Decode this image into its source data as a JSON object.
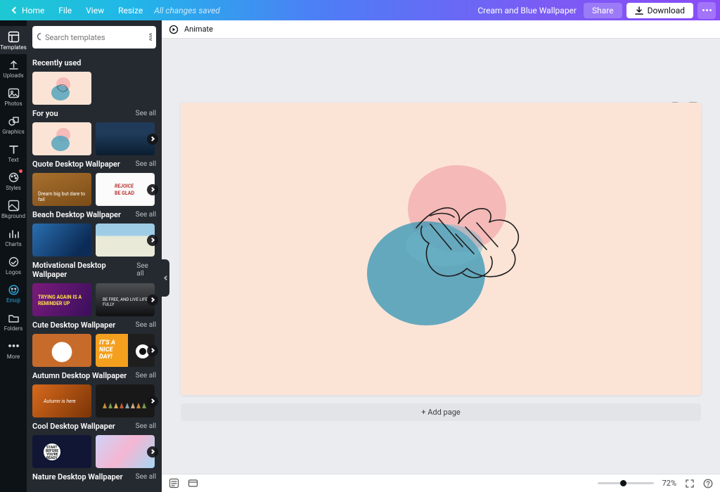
{
  "topbar": {
    "home": "Home",
    "file": "File",
    "view": "View",
    "resize": "Resize",
    "status": "All changes saved",
    "doc_title": "Cream and Blue Wallpaper",
    "share": "Share",
    "download": "Download"
  },
  "rail": [
    {
      "label": "Templates",
      "active": true
    },
    {
      "label": "Uploads"
    },
    {
      "label": "Photos"
    },
    {
      "label": "Graphics"
    },
    {
      "label": "Text"
    },
    {
      "label": "Styles",
      "badge": true
    },
    {
      "label": "Bkground"
    },
    {
      "label": "Charts"
    },
    {
      "label": "Logos"
    },
    {
      "label": "Emoji",
      "active_blue": true
    },
    {
      "label": "Folders"
    },
    {
      "label": "More"
    }
  ],
  "search": {
    "placeholder": "Search templates"
  },
  "sections": {
    "recent": {
      "title": "Recently used"
    },
    "foryou": {
      "title": "For you",
      "see_all": "See all"
    },
    "quote": {
      "title": "Quote Desktop Wallpaper",
      "see_all": "See all"
    },
    "beach": {
      "title": "Beach Desktop Wallpaper",
      "see_all": "See all"
    },
    "motiv": {
      "title": "Motivational Desktop Wallpaper",
      "see_all": "See all"
    },
    "cute": {
      "title": "Cute Desktop Wallpaper",
      "see_all": "See all"
    },
    "autumn": {
      "title": "Autumn Desktop Wallpaper",
      "see_all": "See all"
    },
    "cool": {
      "title": "Cool Desktop Wallpaper",
      "see_all": "See all"
    },
    "nature": {
      "title": "Nature Desktop Wallpaper",
      "see_all": "See all"
    }
  },
  "thumb_text": {
    "quote1": "Dream big but dare to fail",
    "quote2": "REJOICE",
    "quote2b": "BE GLAD",
    "motiv1a": "TRYING AGAIN IS A",
    "motiv1b": "REMINDER UP",
    "motiv2": "BE FREE, AND LIVE LIFE FULLY",
    "nice1": "IT'S A",
    "nice2": "NICE",
    "nice3": "DAY!",
    "autumn1": "Autumn is here",
    "cool1a": "START",
    "cool1b": "BEFORE",
    "cool1c": "YOU'RE",
    "cool1d": "READY"
  },
  "animate": "Animate",
  "add_page": "+ Add page",
  "footer": {
    "zoom": "72%"
  }
}
